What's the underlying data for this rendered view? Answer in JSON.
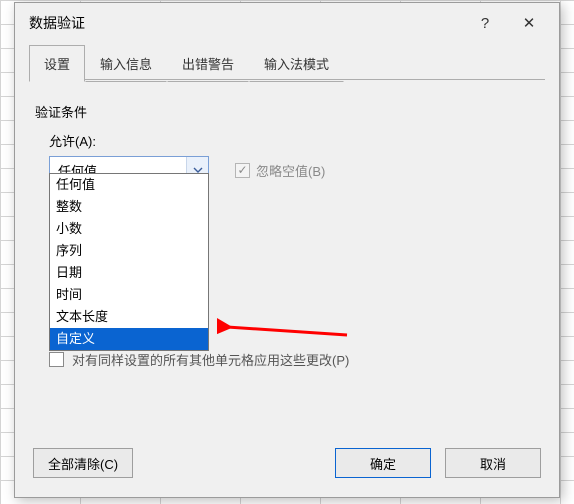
{
  "dialog": {
    "title": "数据验证",
    "help_glyph": "?",
    "close_glyph": "✕"
  },
  "tabs": [
    {
      "label": "设置"
    },
    {
      "label": "输入信息"
    },
    {
      "label": "出错警告"
    },
    {
      "label": "输入法模式"
    }
  ],
  "section": {
    "criteria_label": "验证条件"
  },
  "allow": {
    "label": "允许(A):",
    "selected": "任何值",
    "options": [
      "任何值",
      "整数",
      "小数",
      "序列",
      "日期",
      "时间",
      "文本长度",
      "自定义"
    ],
    "highlight_index": 7
  },
  "ignore_blank": {
    "label": "忽略空值(B)",
    "checked": true,
    "disabled": true
  },
  "apply_all": {
    "label": "对有同样设置的所有其他单元格应用这些更改(P)",
    "checked": false
  },
  "footer": {
    "clear_all": "全部清除(C)",
    "ok": "确定",
    "cancel": "取消"
  }
}
